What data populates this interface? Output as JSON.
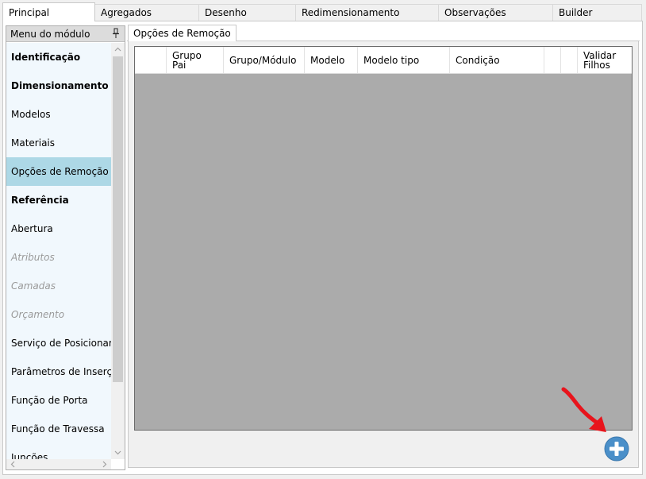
{
  "top_tabs": [
    "Principal",
    "Agregados",
    "Desenho",
    "Redimensionamento",
    "Observações",
    "Builder"
  ],
  "side_menu": {
    "title": "Menu do módulo",
    "items": [
      {
        "label": "Identificação",
        "style": "bold"
      },
      {
        "label": "Dimensionamento",
        "style": "bold"
      },
      {
        "label": "Modelos",
        "style": "normal"
      },
      {
        "label": "Materiais",
        "style": "normal"
      },
      {
        "label": "Opções de Remoção",
        "style": "selected"
      },
      {
        "label": "Referência",
        "style": "bold"
      },
      {
        "label": "Abertura",
        "style": "normal"
      },
      {
        "label": "Atributos",
        "style": "disabled"
      },
      {
        "label": "Camadas",
        "style": "disabled"
      },
      {
        "label": "Orçamento",
        "style": "disabled"
      },
      {
        "label": "Serviço de Posicionamento",
        "style": "normal"
      },
      {
        "label": "Parâmetros de Inserção",
        "style": "normal"
      },
      {
        "label": "Função de Porta",
        "style": "normal"
      },
      {
        "label": "Função de Travessa",
        "style": "normal"
      },
      {
        "label": "Junções",
        "style": "normal"
      }
    ]
  },
  "content": {
    "tab_label": "Opções de Remoção",
    "grid_columns": [
      "",
      "Grupo\nPai",
      "Grupo/Módulo",
      "Modelo",
      "Modelo tipo",
      "Condição",
      "",
      "",
      "Validar\nFilhos"
    ]
  },
  "icons": {
    "add": "plus-circle-icon",
    "pin": "pin-icon",
    "annotation": "red-arrow-icon"
  },
  "colors": {
    "accent_blue": "#4a8fc9",
    "selected_item": "#add8e6",
    "grid_empty": "#ababab",
    "annotation_red": "#e8141c"
  }
}
